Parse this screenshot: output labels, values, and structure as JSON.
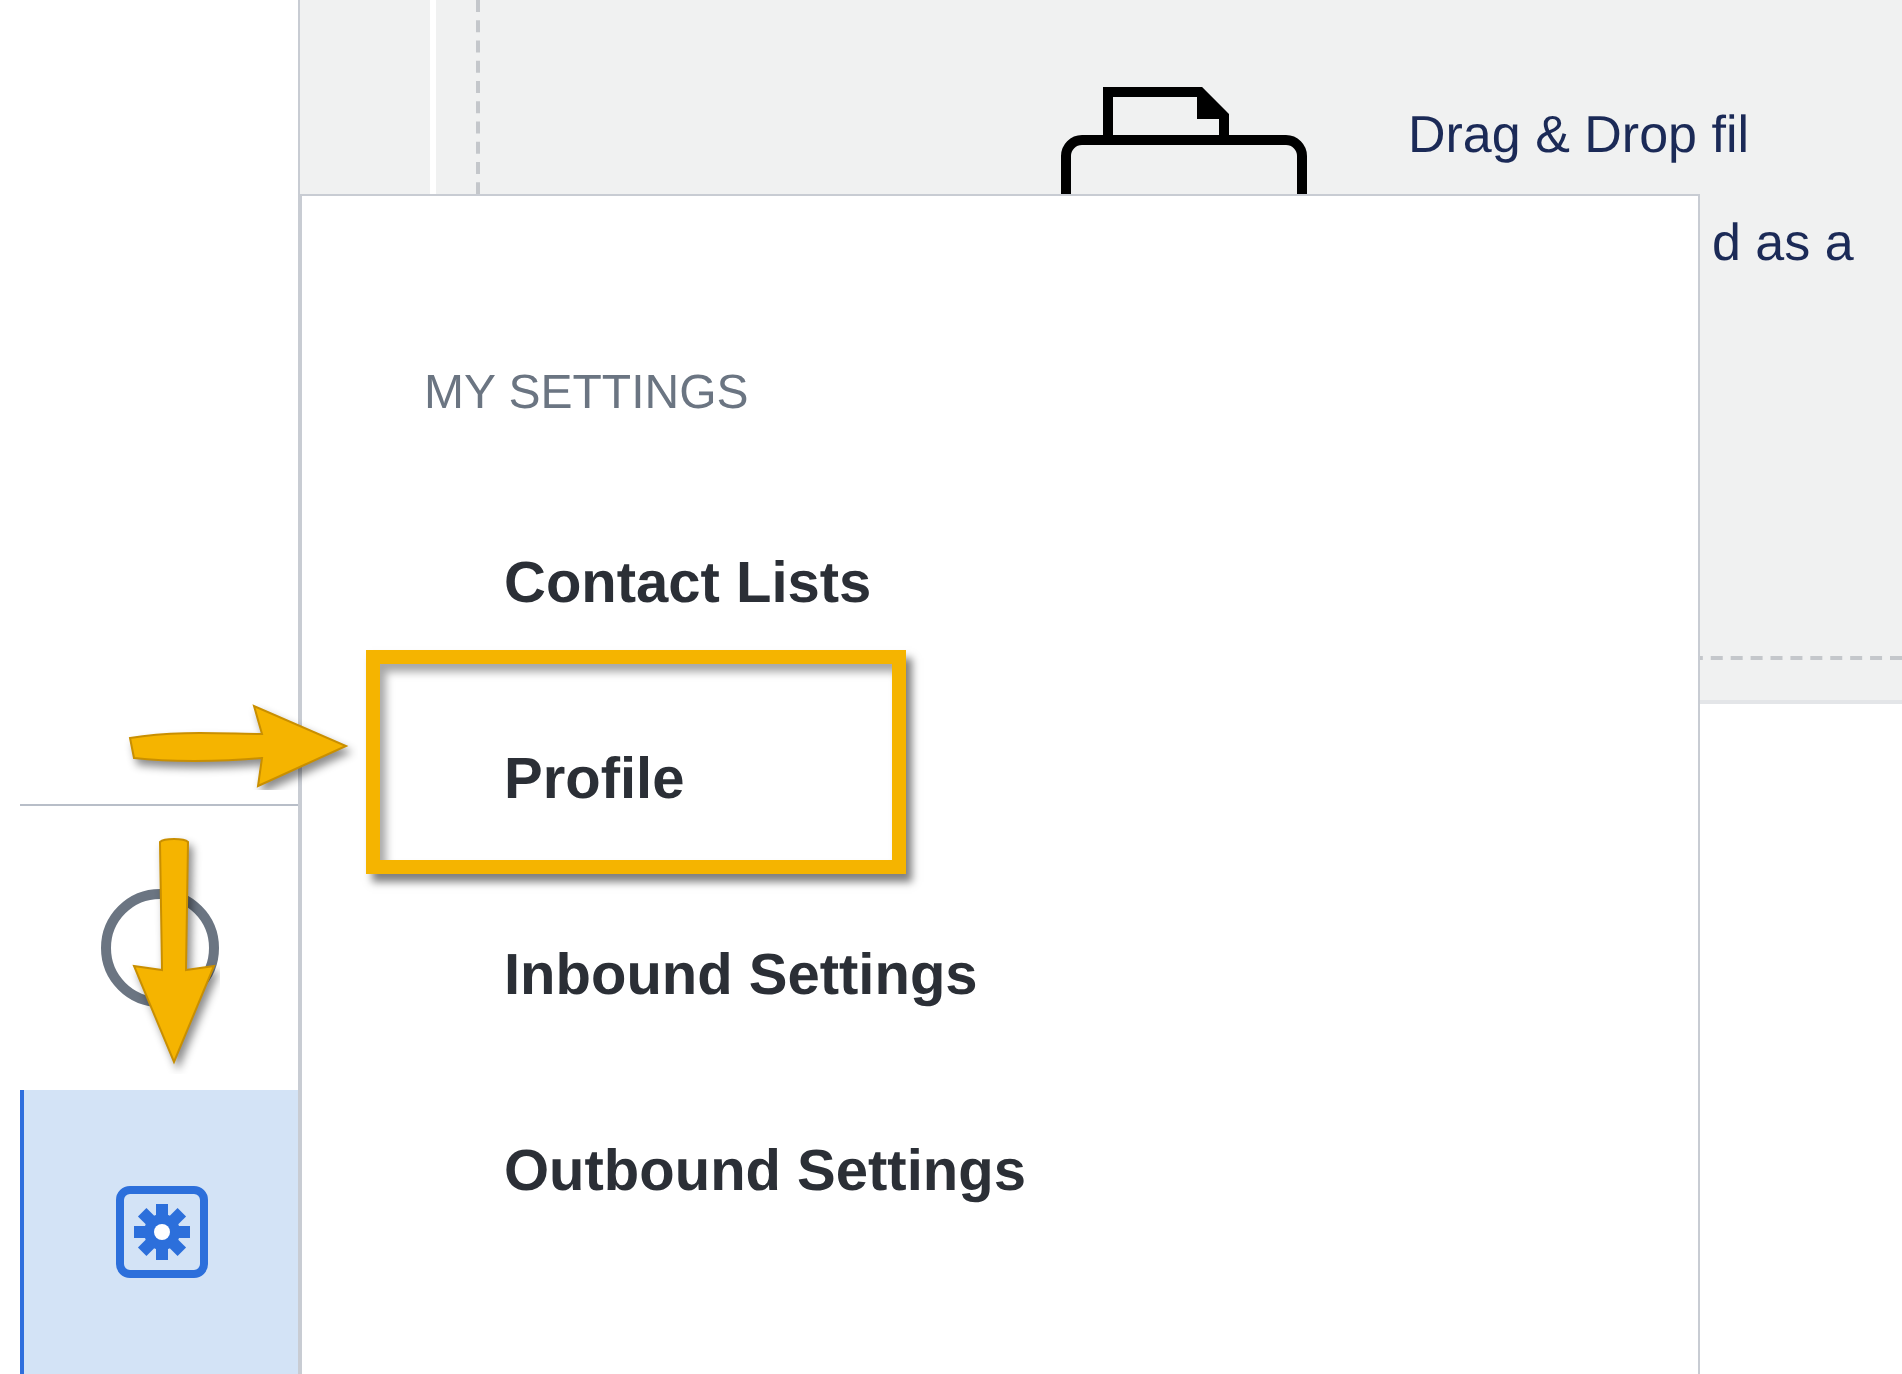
{
  "upload": {
    "line_1": "Drag & Drop fil",
    "line_2": "d as a"
  },
  "sidebar": {
    "items": [
      {
        "kind": "circle",
        "selected": false
      },
      {
        "kind": "gear",
        "selected": true
      }
    ]
  },
  "menu": {
    "heading": "MY SETTINGS",
    "items": [
      {
        "label": "Contact Lists",
        "highlighted": false
      },
      {
        "label": "Profile",
        "highlighted": true
      },
      {
        "label": "Inbound Settings",
        "highlighted": false
      },
      {
        "label": "Outbound Settings",
        "highlighted": false
      }
    ]
  }
}
